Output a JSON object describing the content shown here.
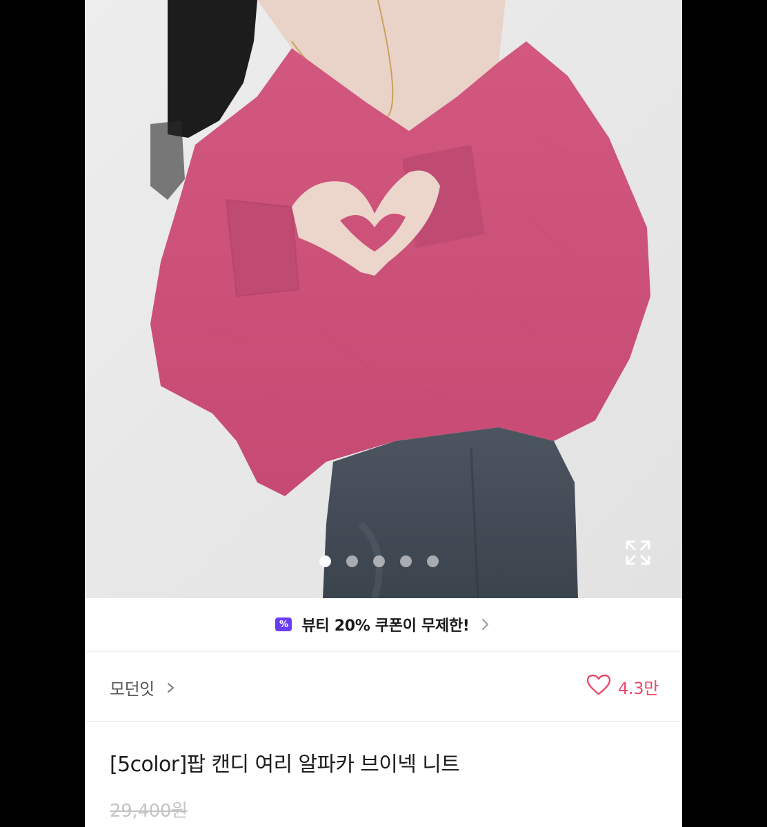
{
  "product_image": {
    "alt": "",
    "carousel": {
      "total_dots": 5,
      "active_index": 0
    },
    "expand_icon": "expand-icon"
  },
  "coupon_banner": {
    "icon": "percent-coupon-icon",
    "icon_glyph": "%",
    "text": "뷰티 20% 쿠폰이 무제한!",
    "accent_color": "#6a3df2"
  },
  "brand": {
    "name": "모던잇",
    "chevron_icon": "chevron-right-icon"
  },
  "likes": {
    "icon": "heart-icon",
    "count": "4.3만",
    "color": "#ea4a6a"
  },
  "product": {
    "title": "[5color]팝 캔디 여리 알파카 브이넥 니트",
    "original_price": "29,400원"
  }
}
